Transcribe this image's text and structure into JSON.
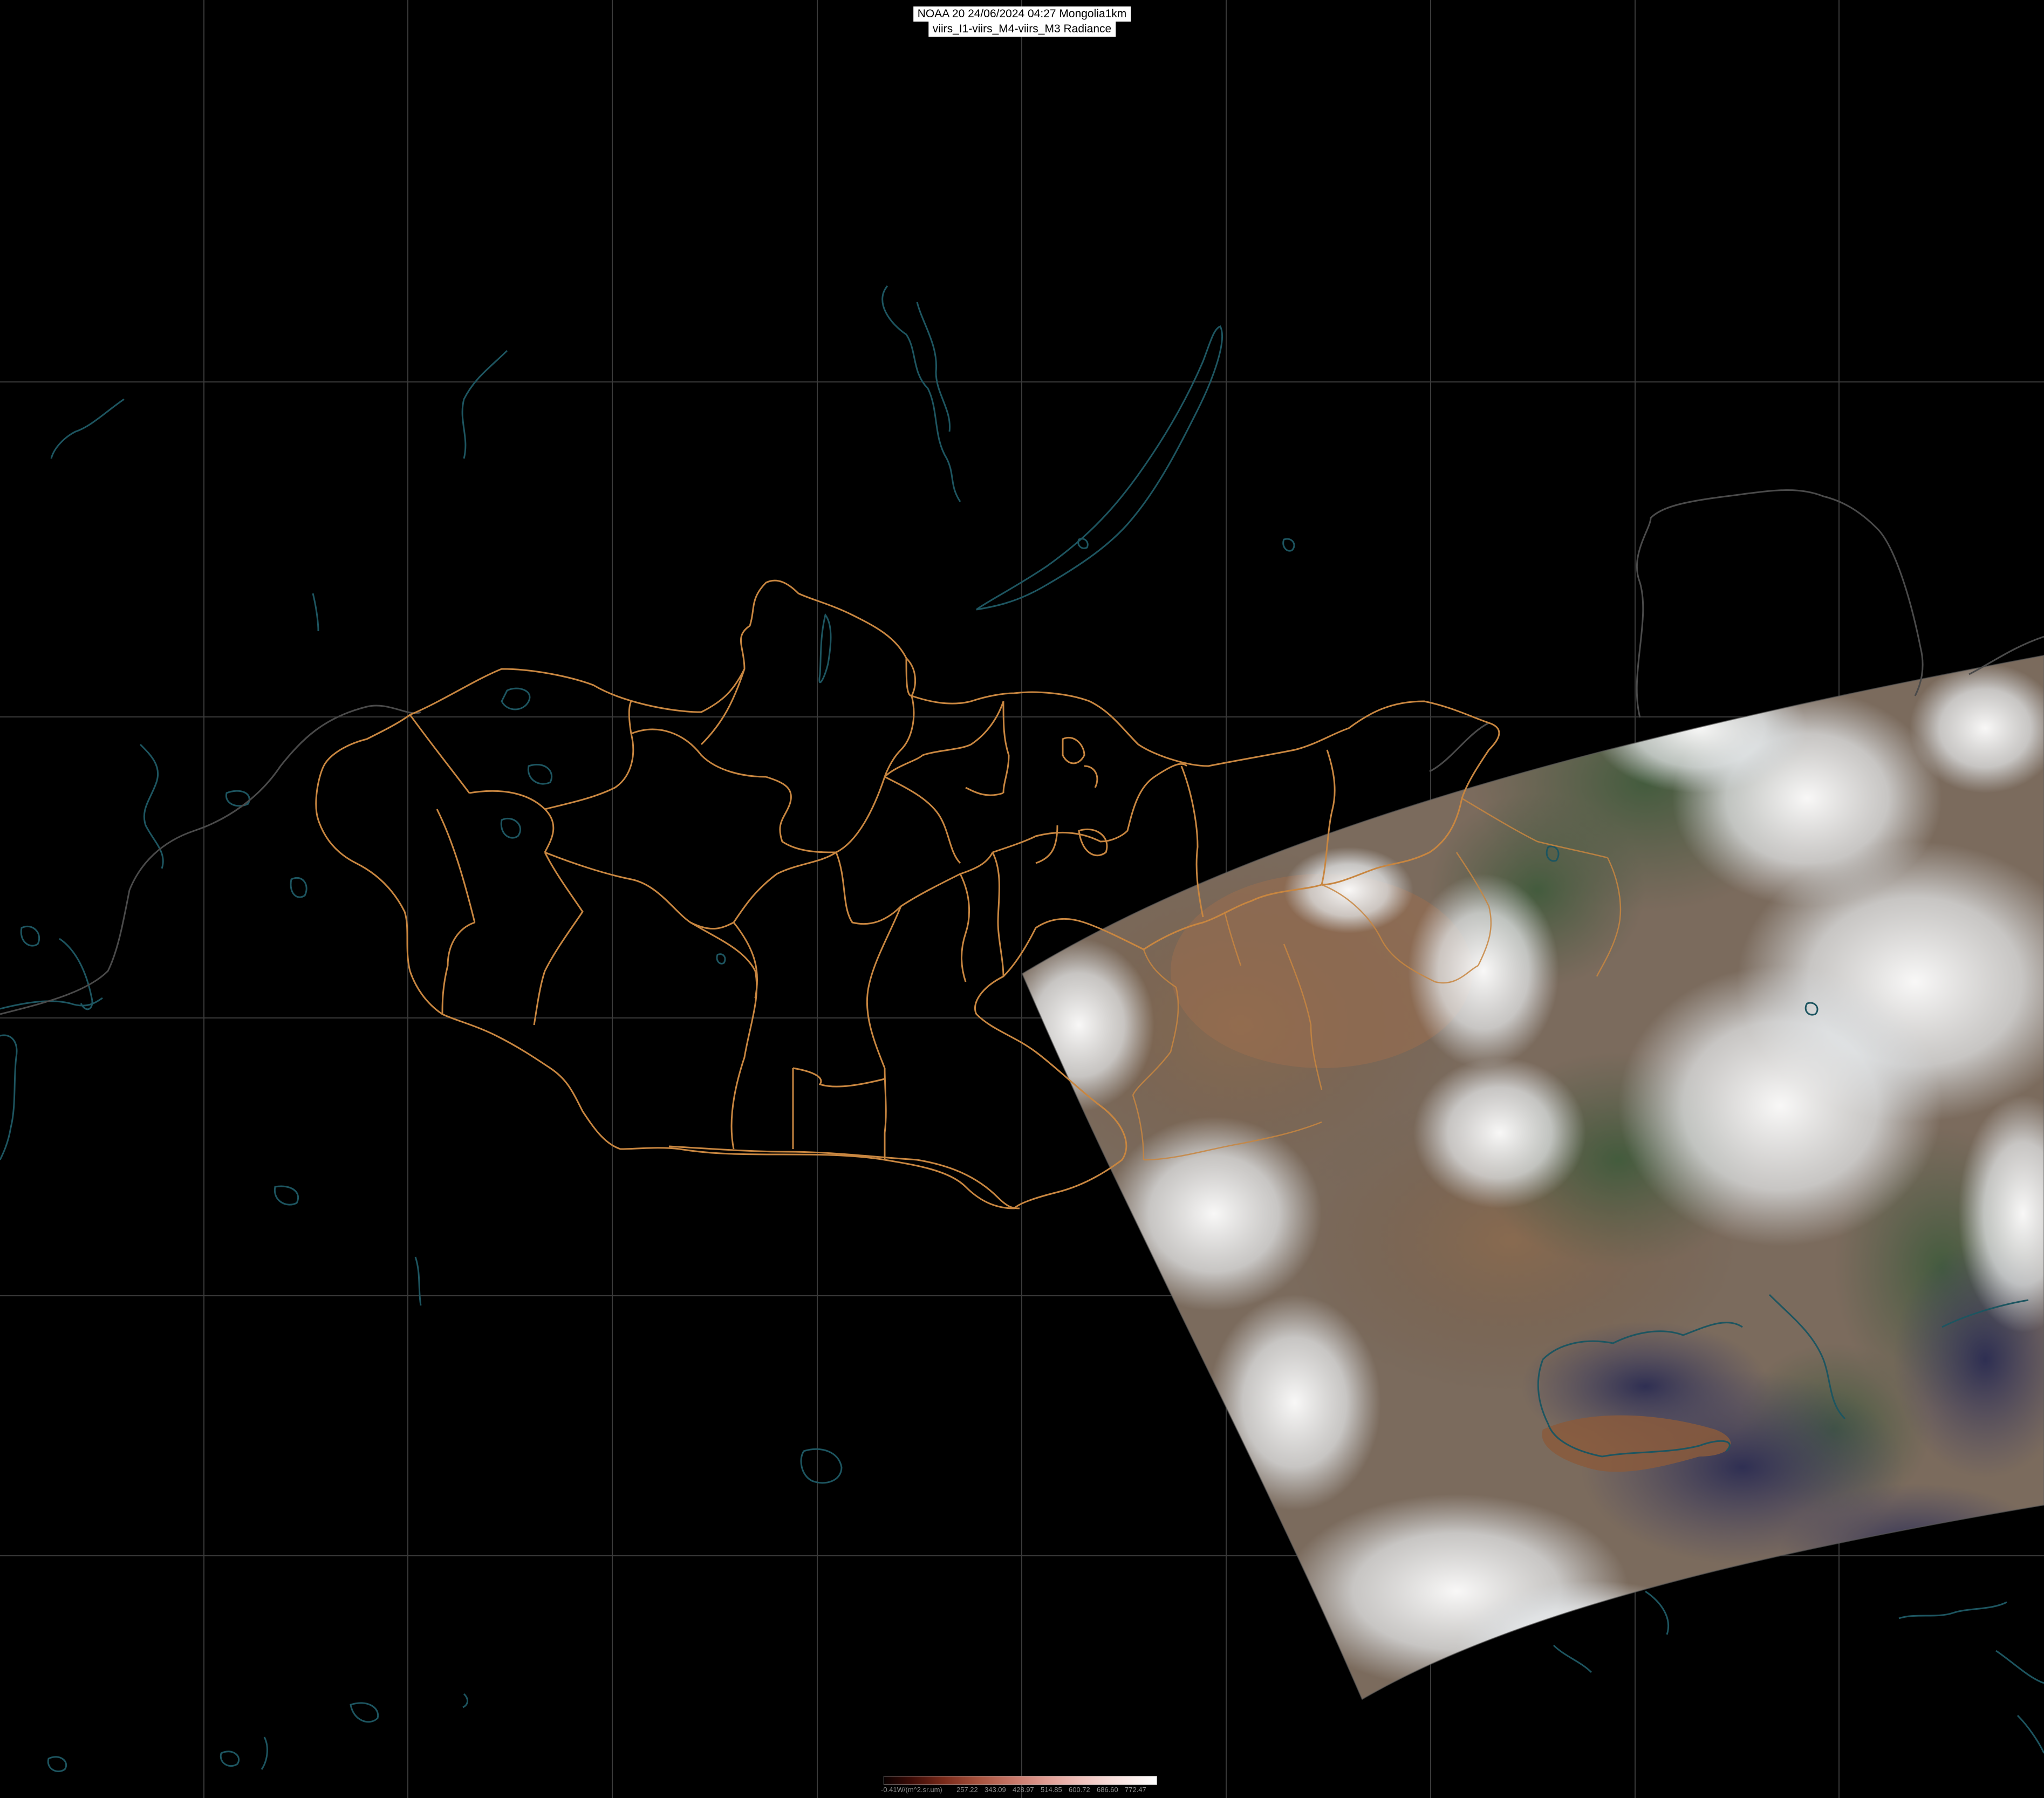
{
  "title": {
    "line1": "NOAA 20 24/06/2024 04:27 Mongolia1km",
    "line2": "viirs_I1-viirs_M4-viirs_M3 Radiance"
  },
  "legend": {
    "unit_label": "-0.41W/(m^2.sr.um)",
    "ticks": [
      "257.22",
      "343.09",
      "428.97",
      "514.85",
      "600.72",
      "686.60",
      "772.47"
    ],
    "gradient_colors": [
      "#0a0000",
      "#7a2a1a",
      "#c9786a",
      "#f0c0bb",
      "#ffffff"
    ]
  },
  "map": {
    "background_color": "#000000",
    "graticule_color": "#3a3a3a",
    "admin_boundary_color": "#c88640",
    "coastline_color": "#1d5560",
    "swath_present": true
  }
}
